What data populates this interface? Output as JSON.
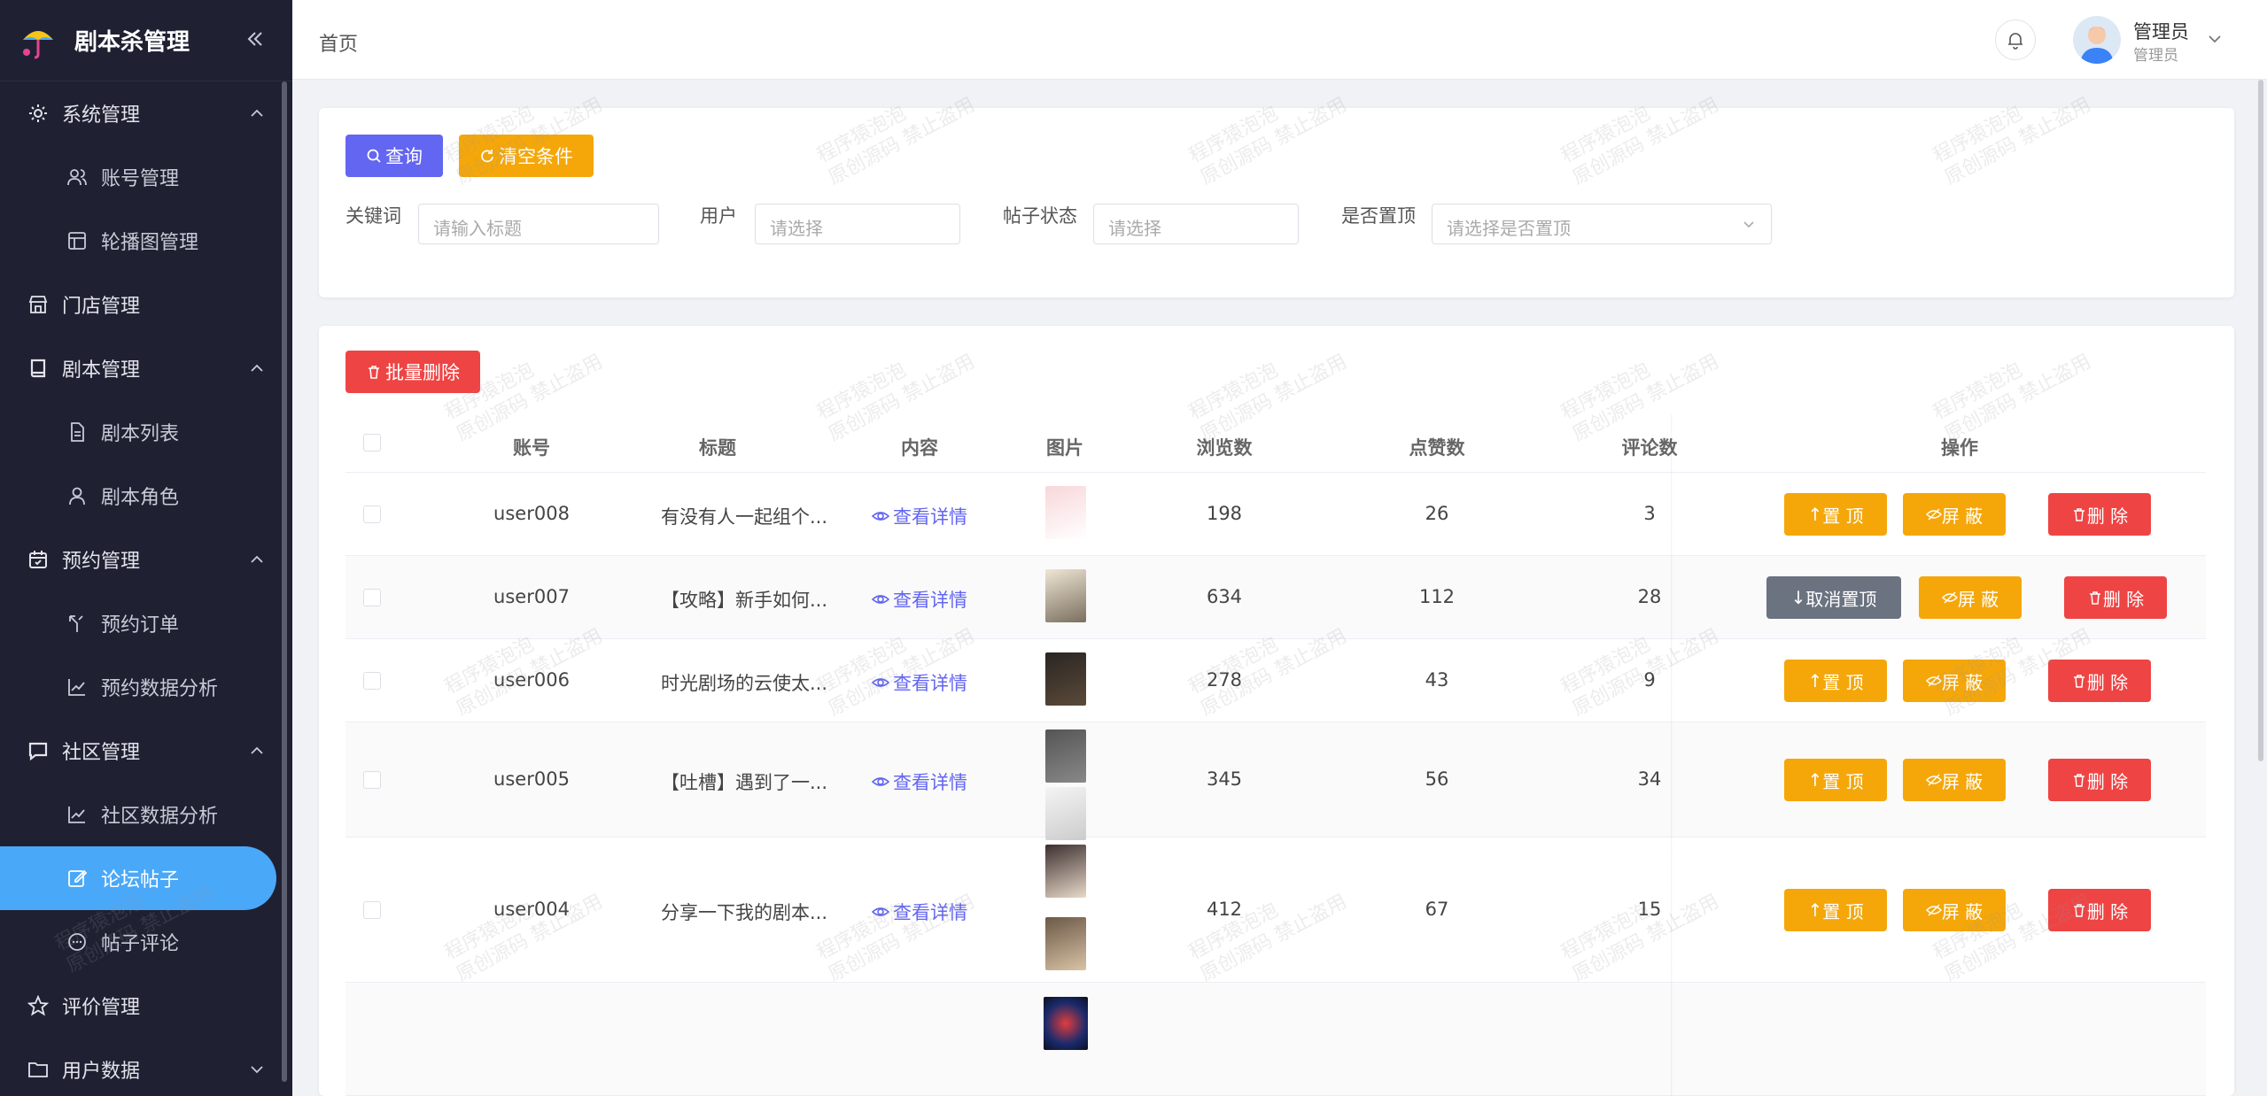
{
  "app": {
    "title": "剧本杀管理"
  },
  "sidebar": {
    "items": [
      {
        "label": "系统管理",
        "level": 1,
        "icon": "gear-icon",
        "expanded": true
      },
      {
        "label": "账号管理",
        "level": 2,
        "icon": "users-icon"
      },
      {
        "label": "轮播图管理",
        "level": 2,
        "icon": "layout-icon"
      },
      {
        "label": "门店管理",
        "level": 1,
        "icon": "store-icon"
      },
      {
        "label": "剧本管理",
        "level": 1,
        "icon": "book-icon",
        "expanded": true
      },
      {
        "label": "剧本列表",
        "level": 2,
        "icon": "file-icon"
      },
      {
        "label": "剧本角色",
        "level": 2,
        "icon": "user-icon"
      },
      {
        "label": "预约管理",
        "level": 1,
        "icon": "calendar-icon",
        "expanded": true
      },
      {
        "label": "预约订单",
        "level": 2,
        "icon": "route-icon"
      },
      {
        "label": "预约数据分析",
        "level": 2,
        "icon": "chart-line-icon"
      },
      {
        "label": "社区管理",
        "level": 1,
        "icon": "message-icon",
        "expanded": true
      },
      {
        "label": "社区数据分析",
        "level": 2,
        "icon": "chart-line-icon"
      },
      {
        "label": "论坛帖子",
        "level": 2,
        "icon": "edit-icon",
        "active": true
      },
      {
        "label": "帖子评论",
        "level": 2,
        "icon": "comment-icon"
      },
      {
        "label": "评价管理",
        "level": 1,
        "icon": "star-icon"
      },
      {
        "label": "用户数据",
        "level": 1,
        "icon": "folder-icon",
        "expanded": false
      }
    ]
  },
  "header": {
    "breadcrumb": "首页",
    "user_name": "管理员",
    "user_role": "管理员"
  },
  "filters": {
    "query_label": "查询",
    "clear_label": "清空条件",
    "keyword_label": "关键词",
    "keyword_placeholder": "请输入标题",
    "user_label": "用户",
    "user_placeholder": "请选择",
    "status_label": "帖子状态",
    "status_placeholder": "请选择",
    "pinned_label": "是否置顶",
    "pinned_placeholder": "请选择是否置顶"
  },
  "table": {
    "batch_delete_label": "批量删除",
    "columns": [
      "账号",
      "标题",
      "内容",
      "图片",
      "浏览数",
      "点赞数",
      "评论数",
      "操作"
    ],
    "detail_label": "查看详情",
    "action_top": "置 顶",
    "action_untop": "取消置顶",
    "action_hide": "屏 蔽",
    "action_delete": "删 除",
    "rows": [
      {
        "account": "user008",
        "title": "有没有人一起组个...",
        "views": "198",
        "likes": "26",
        "comments": "3",
        "pinned": false
      },
      {
        "account": "user007",
        "title": "【攻略】新手如何...",
        "views": "634",
        "likes": "112",
        "comments": "28",
        "pinned": true
      },
      {
        "account": "user006",
        "title": "时光剧场的云使太...",
        "views": "278",
        "likes": "43",
        "comments": "9",
        "pinned": false
      },
      {
        "account": "user005",
        "title": "【吐槽】遇到了一...",
        "views": "345",
        "likes": "56",
        "comments": "34",
        "pinned": false
      },
      {
        "account": "user004",
        "title": "分享一下我的剧本...",
        "views": "412",
        "likes": "67",
        "comments": "15",
        "pinned": false
      }
    ]
  },
  "watermark": {
    "line1": "程序猿泡泡",
    "line2": "原创源码 禁止盗用"
  },
  "colors": {
    "sidebar_bg": "#1f2133",
    "active": "#4aa8f8",
    "primary": "#6366f1",
    "warning": "#f5a70a",
    "danger": "#ef4444",
    "muted": "#6b7280"
  }
}
